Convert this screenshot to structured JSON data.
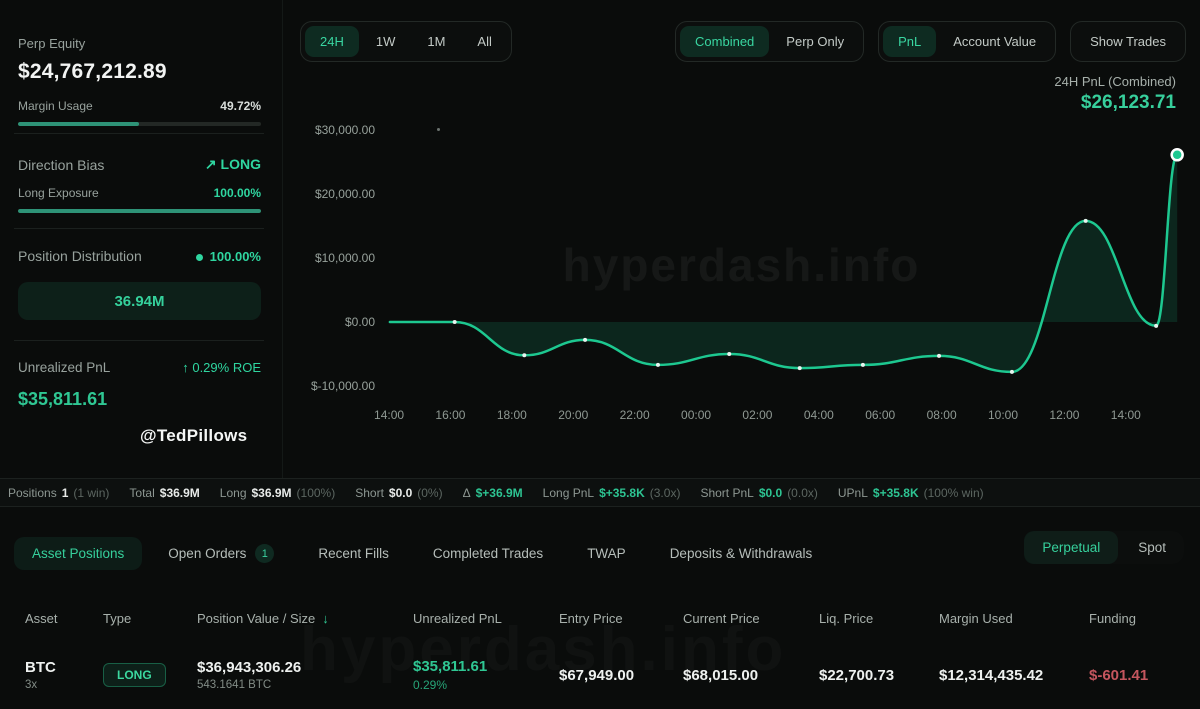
{
  "sidebar": {
    "perp_equity": {
      "label": "Perp Equity",
      "value": "$24,767,212.89",
      "margin_usage_label": "Margin Usage",
      "margin_usage_value": "49.72%",
      "margin_usage_pct": 49.72
    },
    "direction_bias": {
      "label": "Direction Bias",
      "value": "LONG",
      "trend_icon": "↗",
      "exposure_label": "Long Exposure",
      "exposure_value": "100.00%",
      "exposure_pct": 100
    },
    "position_distribution": {
      "label": "Position Distribution",
      "value": "100.00%",
      "block_label": "36.94M"
    },
    "unrealized_pnl": {
      "label": "Unrealized PnL",
      "roe_icon": "↑",
      "roe": "0.29% ROE",
      "value": "$35,811.61"
    },
    "handle": "@TedPillows"
  },
  "toolbar": {
    "timeframes": [
      {
        "label": "24H",
        "active": true
      },
      {
        "label": "1W",
        "active": false
      },
      {
        "label": "1M",
        "active": false
      },
      {
        "label": "All",
        "active": false
      }
    ],
    "scope": [
      {
        "label": "Combined",
        "active": true
      },
      {
        "label": "Perp Only",
        "active": false
      }
    ],
    "metric": [
      {
        "label": "PnL",
        "active": true
      },
      {
        "label": "Account Value",
        "active": false
      }
    ],
    "show_trades_label": "Show Trades"
  },
  "chart": {
    "pnl_label": "24H PnL (Combined)",
    "pnl_value": "$26,123.71",
    "watermark": "hyperdash.info"
  },
  "chart_data": {
    "type": "area",
    "title": "24H PnL (Combined)",
    "unit": "USD",
    "final_value": 26123.71,
    "ylim": [
      -10000,
      30000
    ],
    "grid": false,
    "legend": null,
    "line_color": "#1dc890",
    "fill_opacity": 0.14,
    "y_ticks": [
      "$30,000.00",
      "$20,000.00",
      "$10,000.00",
      "$0.00",
      "$-10,000.00"
    ],
    "y_tick_values": [
      30000,
      20000,
      10000,
      0,
      -10000
    ],
    "x_ticks": [
      "14:00",
      "16:00",
      "18:00",
      "20:00",
      "22:00",
      "00:00",
      "02:00",
      "04:00",
      "06:00",
      "08:00",
      "10:00",
      "12:00",
      "14:00"
    ],
    "points": [
      {
        "x": 0.006,
        "t": "14:00",
        "v": 0
      },
      {
        "x": 0.086,
        "t": "16:10",
        "v": 0
      },
      {
        "x": 0.172,
        "t": "18:20",
        "v": -5200
      },
      {
        "x": 0.247,
        "t": "20:20",
        "v": -2800
      },
      {
        "x": 0.337,
        "t": "22:45",
        "v": -6700
      },
      {
        "x": 0.425,
        "t": "01:00",
        "v": -5000
      },
      {
        "x": 0.512,
        "t": "03:30",
        "v": -7200
      },
      {
        "x": 0.59,
        "t": "05:30",
        "v": -6700
      },
      {
        "x": 0.684,
        "t": "08:00",
        "v": -5300
      },
      {
        "x": 0.774,
        "t": "10:20",
        "v": -7800
      },
      {
        "x": 0.865,
        "t": "12:45",
        "v": 15800
      },
      {
        "x": 0.952,
        "t": "14:10",
        "v": -600
      },
      {
        "x": 0.978,
        "t": "14:40",
        "v": 26123.71
      }
    ]
  },
  "stats": {
    "items": [
      {
        "label": "Positions",
        "value": "1",
        "paren": "(1 win)",
        "green": false
      },
      {
        "label": "Total",
        "value": "$36.9M",
        "paren": "",
        "green": false
      },
      {
        "label": "Long",
        "value": "$36.9M",
        "paren": "(100%)",
        "green": false
      },
      {
        "label": "Short",
        "value": "$0.0",
        "paren": "(0%)",
        "green": false
      },
      {
        "label": "Δ",
        "value": "$+36.9M",
        "paren": "",
        "green": true
      },
      {
        "label": "Long PnL",
        "value": "$+35.8K",
        "paren": "(3.0x)",
        "green": true
      },
      {
        "label": "Short PnL",
        "value": "$0.0",
        "paren": "(0.0x)",
        "green": true
      },
      {
        "label": "UPnL",
        "value": "$+35.8K",
        "paren": "(100% win)",
        "green": true
      }
    ]
  },
  "tabs": {
    "items": [
      {
        "label": "Asset Positions",
        "active": true,
        "badge": ""
      },
      {
        "label": "Open Orders",
        "active": false,
        "badge": "1"
      },
      {
        "label": "Recent Fills",
        "active": false,
        "badge": ""
      },
      {
        "label": "Completed Trades",
        "active": false,
        "badge": ""
      },
      {
        "label": "TWAP",
        "active": false,
        "badge": ""
      },
      {
        "label": "Deposits & Withdrawals",
        "active": false,
        "badge": ""
      }
    ],
    "market_toggle": [
      {
        "label": "Perpetual",
        "active": true
      },
      {
        "label": "Spot",
        "active": false
      }
    ]
  },
  "table": {
    "headers": [
      {
        "label": "Asset",
        "sort": ""
      },
      {
        "label": "Type",
        "sort": ""
      },
      {
        "label": "Position Value / Size",
        "sort": "↓"
      },
      {
        "label": "Unrealized PnL",
        "sort": ""
      },
      {
        "label": "Entry Price",
        "sort": ""
      },
      {
        "label": "Current Price",
        "sort": ""
      },
      {
        "label": "Liq. Price",
        "sort": ""
      },
      {
        "label": "Margin Used",
        "sort": ""
      },
      {
        "label": "Funding",
        "sort": ""
      }
    ],
    "rows": [
      {
        "asset": "BTC",
        "leverage": "3x",
        "type": "LONG",
        "position_value": "$36,943,306.26",
        "position_size": "543.1641 BTC",
        "unrealized_pnl": "$35,811.61",
        "roe": "0.29%",
        "entry_price": "$67,949.00",
        "current_price": "$68,015.00",
        "liq_price": "$22,700.73",
        "margin_used": "$12,314,435.42",
        "funding": "$-601.41"
      }
    ],
    "watermark": "hyperdash.info"
  },
  "colors": {
    "accent_green": "#2fd6a0",
    "line_green": "#1dc890",
    "negative_red": "#c4565e",
    "background": "#0a0c0b"
  }
}
